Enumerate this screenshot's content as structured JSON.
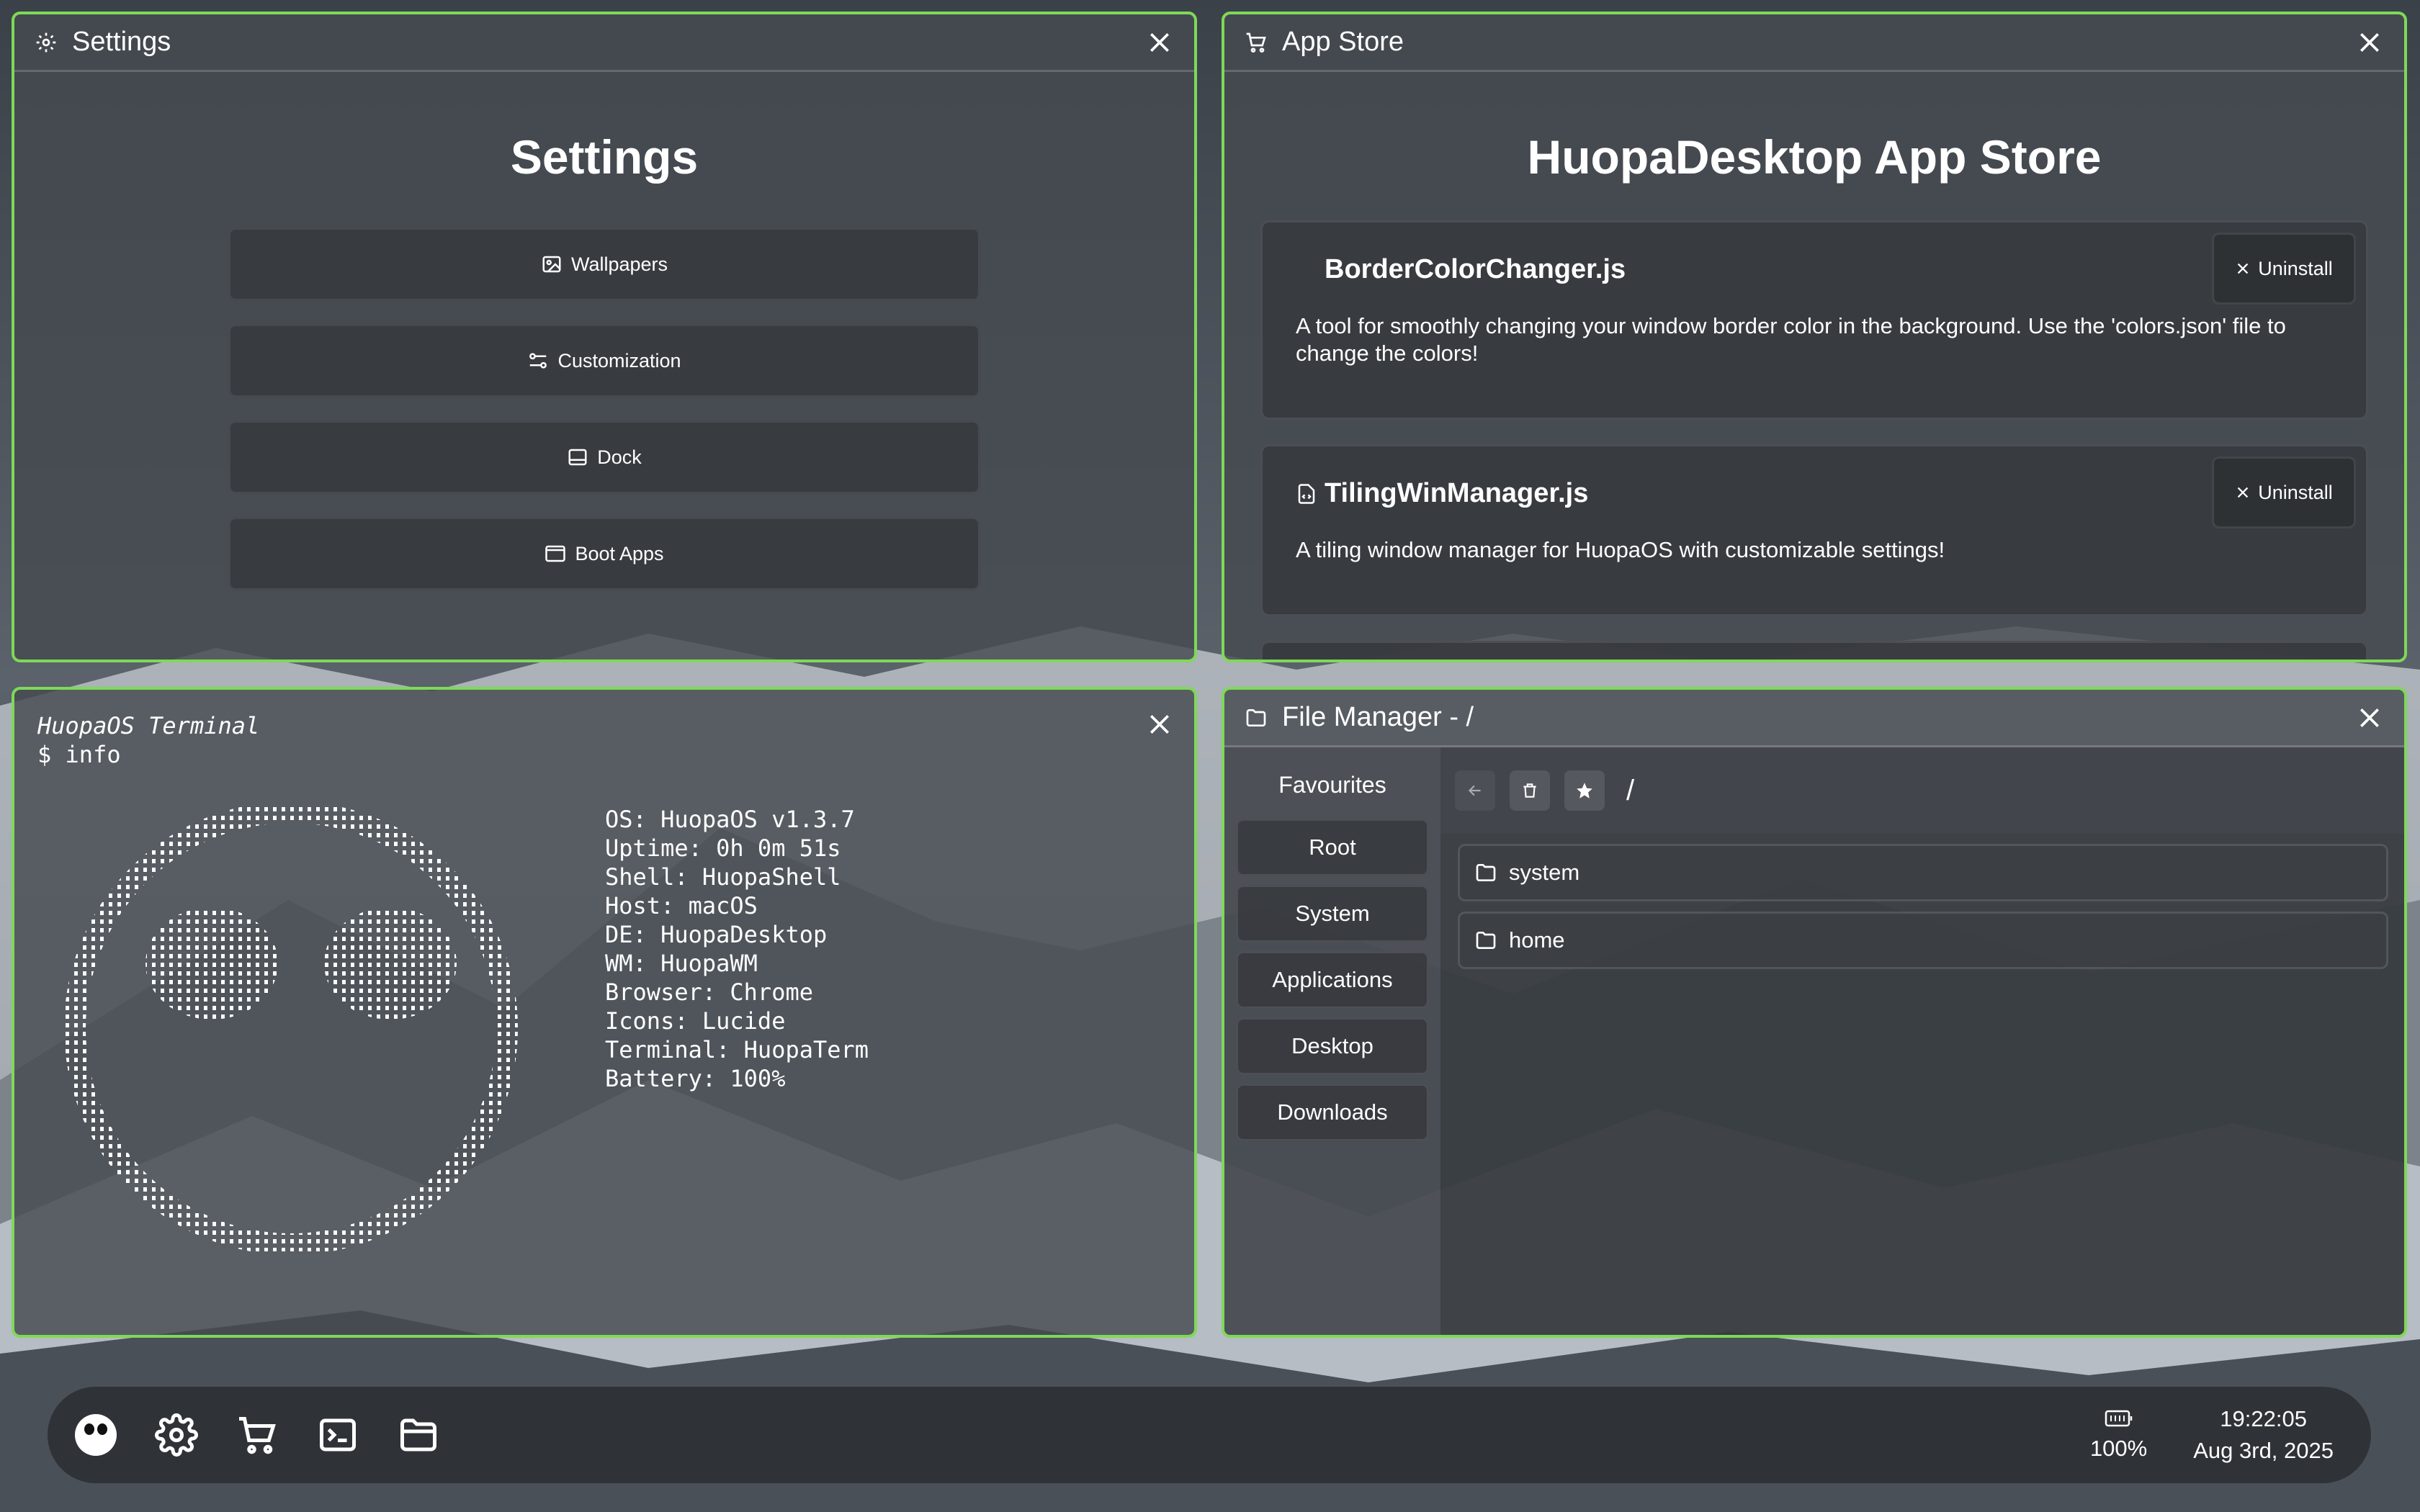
{
  "desktop": {
    "wallpaper": "snowy-mountains"
  },
  "windows": {
    "settings": {
      "title": "Settings",
      "heading": "Settings",
      "buttons": [
        {
          "label": "Wallpapers",
          "icon": "image-icon"
        },
        {
          "label": "Customization",
          "icon": "sliders-icon"
        },
        {
          "label": "Dock",
          "icon": "dock-icon"
        },
        {
          "label": "Boot Apps",
          "icon": "app-window-icon"
        }
      ]
    },
    "store": {
      "title": "App Store",
      "heading": "HuopaDesktop App Store",
      "apps": [
        {
          "name": "BorderColorChanger.js",
          "description": "A tool for smoothly changing your window border color in the background. Use the 'colors.json' file to change the colors!",
          "action": "Uninstall"
        },
        {
          "name": "TilingWinManager.js",
          "description": "A tiling window manager for HuopaOS with customizable settings!",
          "action": "Uninstall"
        }
      ]
    },
    "terminal": {
      "header": "HuopaOS Terminal",
      "command": "$ info",
      "info": [
        "OS: HuopaOS v1.3.7",
        "Uptime: 0h 0m 51s",
        "Shell: HuopaShell",
        "Host: macOS",
        "DE: HuopaDesktop",
        "WM: HuopaWM",
        "Browser: Chrome",
        "Icons: Lucide",
        "Terminal: HuopaTerm",
        "Battery: 100%"
      ]
    },
    "files": {
      "title": "File Manager - /",
      "favourites_label": "Favourites",
      "favourites": [
        "Root",
        "System",
        "Applications",
        "Desktop",
        "Downloads"
      ],
      "path": "/",
      "entries": [
        "system",
        "home"
      ]
    }
  },
  "dock": {
    "apps": [
      "huopa-logo-icon",
      "settings-icon",
      "cart-icon",
      "terminal-icon",
      "folder-icon"
    ],
    "battery": "100%",
    "time": "19:22:05",
    "date": "Aug 3rd, 2025"
  },
  "colors": {
    "window_border": "#7ed957",
    "window_bg": "#464a50"
  }
}
